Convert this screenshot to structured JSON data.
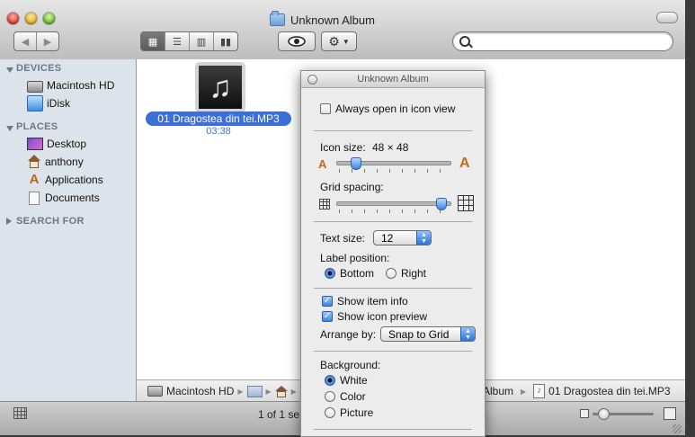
{
  "window": {
    "title": "Unknown Album",
    "view_buttons": [
      "icon",
      "list",
      "column",
      "cover-flow"
    ],
    "active_view": "icon"
  },
  "sidebar": {
    "devices_header": "DEVICES",
    "devices": [
      {
        "label": "Macintosh HD",
        "icon": "hard-drive-icon"
      },
      {
        "label": "iDisk",
        "icon": "idisk-icon"
      }
    ],
    "places_header": "PLACES",
    "places": [
      {
        "label": "Desktop",
        "icon": "desktop-icon"
      },
      {
        "label": "anthony",
        "icon": "home-icon"
      },
      {
        "label": "Applications",
        "icon": "applications-icon"
      },
      {
        "label": "Documents",
        "icon": "documents-icon"
      }
    ],
    "search_header": "SEARCH FOR"
  },
  "file": {
    "name": "01 Dragostea din tei.MP3",
    "duration": "03:38",
    "icon": "music-note-icon"
  },
  "pathbar": {
    "root": "Macintosh HD",
    "album": "Album",
    "file": "01 Dragostea din tei.MP3"
  },
  "status": {
    "text": "1 of 1 se"
  },
  "view_options": {
    "title": "Unknown Album",
    "always_open_label": "Always open in icon view",
    "always_open_checked": false,
    "icon_size_label": "Icon size:",
    "icon_size_value": "48 × 48",
    "icon_size_fraction": 0.14,
    "grid_spacing_label": "Grid spacing:",
    "grid_spacing_fraction": 0.97,
    "text_size_label": "Text size:",
    "text_size_value": "12",
    "label_position_label": "Label position:",
    "label_bottom": "Bottom",
    "label_right": "Right",
    "label_selected": "Bottom",
    "show_item_info": "Show item info",
    "show_item_info_checked": true,
    "show_icon_preview": "Show icon preview",
    "show_icon_preview_checked": true,
    "arrange_by_label": "Arrange by:",
    "arrange_by_value": "Snap to Grid",
    "background_label": "Background:",
    "bg_white": "White",
    "bg_color": "Color",
    "bg_picture": "Picture",
    "bg_selected": "White"
  },
  "colors": {
    "selection_blue": "#3d6fd8",
    "sidebar_bg": "#dde3ea",
    "sidebar_header": "#6d7785"
  }
}
